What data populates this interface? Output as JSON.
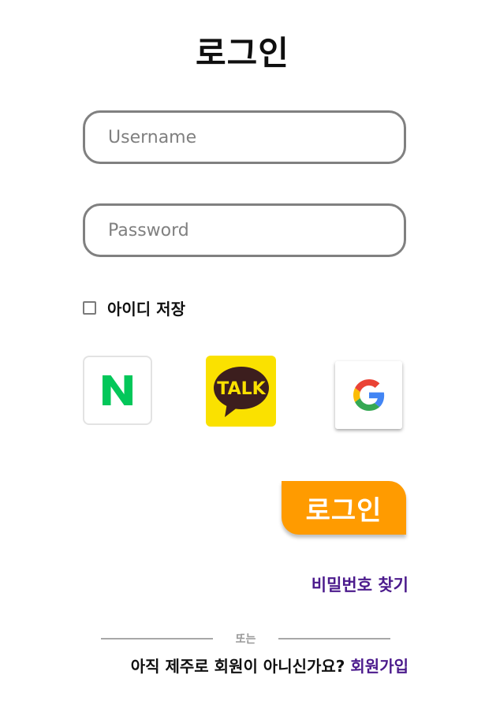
{
  "page": {
    "title": "로그인"
  },
  "form": {
    "username_placeholder": "Username",
    "password_placeholder": "Password",
    "remember_label": "아이디 저장",
    "remember_checked": false
  },
  "social": {
    "naver": {
      "icon": "naver-icon",
      "letter": "N",
      "color": "#03c75a"
    },
    "kakao": {
      "icon": "kakao-talk-icon",
      "text": "TALK",
      "bg": "#fae100",
      "bubble": "#3c1e1e"
    },
    "google": {
      "icon": "google-icon",
      "letter": "G"
    }
  },
  "actions": {
    "login_label": "로그인",
    "login_color": "#ff9b00",
    "find_password": "비밀번호 찾기",
    "link_color": "#4b1a8c"
  },
  "footer": {
    "divider_text": "또는",
    "signup_prompt": "아직 제주로 회원이 아니신가요?",
    "signup_link": "회원가입"
  }
}
